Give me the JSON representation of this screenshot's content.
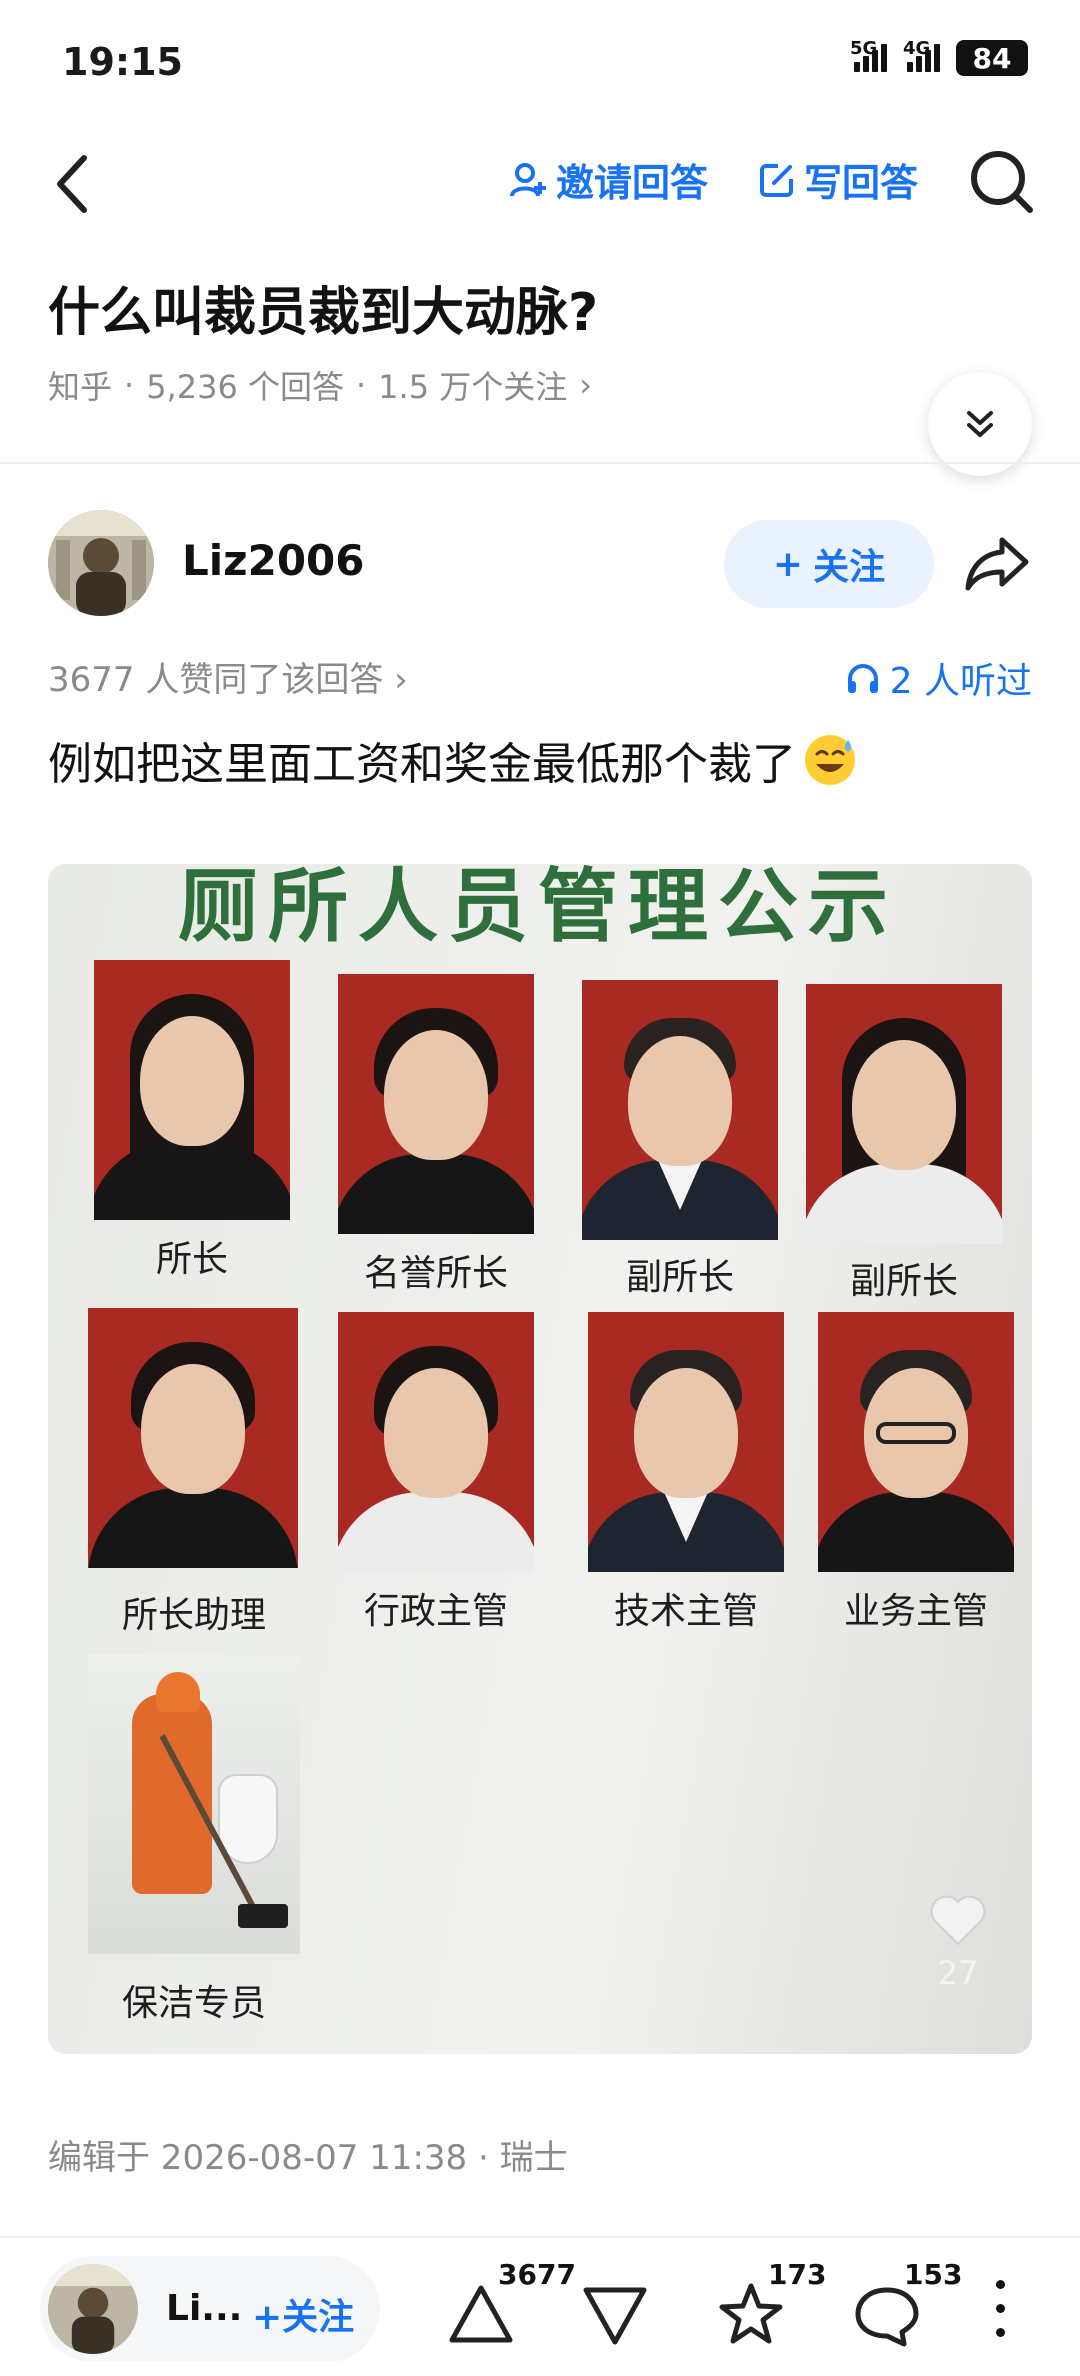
{
  "status_bar": {
    "time": "19:15",
    "network_1": "5G",
    "network_2": "4G",
    "battery": "84"
  },
  "nav": {
    "invite_label": "邀请回答",
    "write_label": "写回答"
  },
  "question": {
    "title": "什么叫裁员裁到大动脉?",
    "source": "知乎",
    "answers": "5,236 个回答",
    "followers": "1.5 万个关注",
    "separator": "·",
    "chevron": "›"
  },
  "author": {
    "name": "Liz2006",
    "short_name": "Li...",
    "follow_label": "关注",
    "follow_plus": "+"
  },
  "answer": {
    "approval": "3677 人赞同了该回答 ›",
    "listeners": "2 人听过",
    "text": "例如把这里面工资和奖金最低那个裁了",
    "emoji": "sweat-smile-emoji",
    "edited": "编辑于 2026-08-07 11:38 · 瑞士"
  },
  "photo": {
    "title": "厕所人员管理公示",
    "roles": [
      "所长",
      "名誉所长",
      "副所长",
      "副所长",
      "所长助理",
      "行政主管",
      "技术主管",
      "业务主管",
      "保洁专员"
    ],
    "like_count": "27"
  },
  "bottom_bar": {
    "upvote_count": "3677",
    "favorite_count": "173",
    "comment_count": "153"
  },
  "colors": {
    "accent": "#1772f6",
    "muted": "#8a8a8a",
    "portrait_bg": "#a82a22",
    "poster_title": "#2f6f3c"
  },
  "icons": [
    "back-icon",
    "invite-icon",
    "write-icon",
    "search-icon",
    "expand-icon",
    "share-icon",
    "headphones-icon",
    "heart-icon",
    "upvote-icon",
    "downvote-icon",
    "star-icon",
    "comment-icon",
    "more-icon"
  ]
}
